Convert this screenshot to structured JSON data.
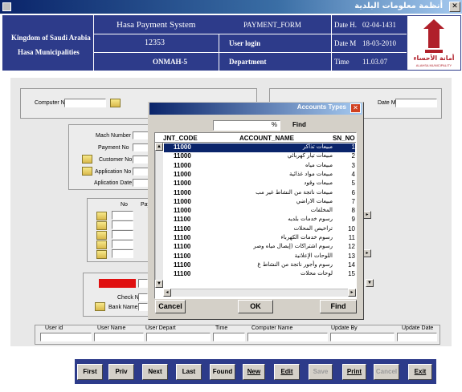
{
  "window": {
    "title": "أنظمة معلومات البلدية"
  },
  "banner": {
    "org_line1": "Kingdom of Saudi Arabia",
    "org_line2": "Hasa Municipalities",
    "system_name": "Hasa Payment System",
    "form_name": "PAYMENT_FORM",
    "user_code": "12353",
    "user_login_label": "User login",
    "terminal": "ONMAH-5",
    "department_label": "Department",
    "date_h_label": "Date H.",
    "date_h": "02-04-1431",
    "date_m_label": "Date M",
    "date_m": "18-03-2010",
    "time_label": "Time",
    "time": "11.03.07",
    "logo_text": "أمانة الأحساء",
    "logo_subtext": "ALAHSA MUNICIPALITY"
  },
  "form": {
    "computer_no_label": "Computer No",
    "date_m_label": "Date M.",
    "mach_number_label": "Mach Number",
    "payment_no_label": "Payment No",
    "customer_no_label": "Customer No",
    "application_no_label": "Application No",
    "application_date_label": "Aplication Date",
    "grid_no_label": "No",
    "grid_pay_label": "Pay",
    "check_no_label": "Check No",
    "bank_name_label": "Bank Name"
  },
  "audit": {
    "columns": [
      "User id",
      "User Name",
      "User Depart",
      "Time",
      "Computer Name",
      "Update By",
      "Update Date"
    ]
  },
  "nav": {
    "buttons": [
      {
        "label": "First",
        "enabled": true
      },
      {
        "label": "Priv",
        "enabled": true
      },
      {
        "label": "Next",
        "enabled": true
      },
      {
        "label": "Last",
        "enabled": true
      },
      {
        "label": "Found",
        "enabled": true
      },
      {
        "label": "New",
        "enabled": true
      },
      {
        "label": "Edit",
        "enabled": true
      },
      {
        "label": "Save",
        "enabled": false
      },
      {
        "label": "Print",
        "enabled": true
      },
      {
        "label": "Cancel",
        "enabled": false
      },
      {
        "label": "Exit",
        "enabled": true
      }
    ]
  },
  "dialog": {
    "title": "Accounts Types",
    "search_value": "%",
    "find_label": "Find",
    "columns": {
      "code": "JNT_CODE",
      "name": "ACCOUNT_NAME",
      "sn": "SN_NO"
    },
    "rows": [
      {
        "code": "11000",
        "name": "مبيعات تذاكر",
        "sn": "1"
      },
      {
        "code": "11000",
        "name": "مبيعات تيار كهربائي",
        "sn": "2"
      },
      {
        "code": "11000",
        "name": "مبيعات مياه",
        "sn": "3"
      },
      {
        "code": "11000",
        "name": "مبيعات مواد غذائية",
        "sn": "4"
      },
      {
        "code": "11000",
        "name": "مبيعات وقود",
        "sn": "5"
      },
      {
        "code": "11000",
        "name": "مبيعات ناتجة من النشاط غير مب",
        "sn": "6"
      },
      {
        "code": "11000",
        "name": "مبيعات الاراضي",
        "sn": "7"
      },
      {
        "code": "11000",
        "name": "المخلفات",
        "sn": "8"
      },
      {
        "code": "11100",
        "name": "رسوم خدمات بلديه",
        "sn": "9"
      },
      {
        "code": "11100",
        "name": "تراخيص المحلات",
        "sn": "10"
      },
      {
        "code": "11100",
        "name": "رسوم خدمات الكهرباء",
        "sn": "11"
      },
      {
        "code": "11100",
        "name": "رسوم اشتراكات (إيصال مياه وصر",
        "sn": "12"
      },
      {
        "code": "11100",
        "name": "اللوحات الإعلانية",
        "sn": "13"
      },
      {
        "code": "11100",
        "name": "رسوم وأجور ناتجة من النشاط غ",
        "sn": "14"
      },
      {
        "code": "11100",
        "name": "لوحات محلات",
        "sn": "15"
      }
    ],
    "selected_row": 0,
    "cancel_label": "Cancel",
    "ok_label": "OK",
    "find_button_label": "Find"
  }
}
